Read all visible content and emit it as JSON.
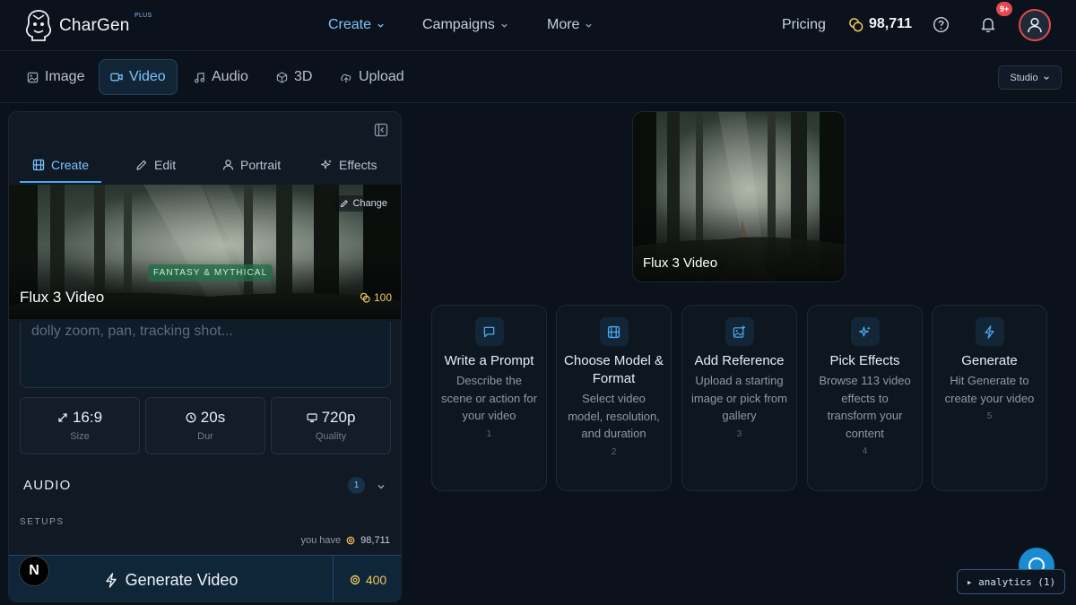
{
  "brand": {
    "name": "CharGen",
    "badge": "PLUS"
  },
  "nav": {
    "links": [
      {
        "label": "Create",
        "active": true
      },
      {
        "label": "Campaigns",
        "active": false
      },
      {
        "label": "More",
        "active": false
      }
    ],
    "pricing": "Pricing",
    "credits": "98,711",
    "notifications_badge": "9+"
  },
  "media_tabs": [
    {
      "label": "Image",
      "icon": "image-icon"
    },
    {
      "label": "Video",
      "icon": "video-icon",
      "active": true
    },
    {
      "label": "Audio",
      "icon": "music-icon"
    },
    {
      "label": "3D",
      "icon": "cube-icon"
    },
    {
      "label": "Upload",
      "icon": "upload-icon"
    }
  ],
  "studio_select": "Studio",
  "panel": {
    "tabs": [
      {
        "label": "Create",
        "icon": "film-icon",
        "active": true
      },
      {
        "label": "Edit",
        "icon": "pencil-icon"
      },
      {
        "label": "Portrait",
        "icon": "user-icon"
      },
      {
        "label": "Effects",
        "icon": "sparkles-icon"
      }
    ],
    "model": {
      "change_label": "Change",
      "genre": "FANTASY & MYTHICAL",
      "name": "Flux 3 Video",
      "cost": "100"
    },
    "prompt_placeholder": "dolly zoom, pan, tracking shot...",
    "options": [
      {
        "value": "16:9",
        "label": "Size",
        "icon": "resize-icon"
      },
      {
        "value": "20s",
        "label": "Dur",
        "icon": "clock-icon"
      },
      {
        "value": "720p",
        "label": "Quality",
        "icon": "monitor-icon"
      }
    ],
    "audio": {
      "title": "AUDIO",
      "count": "1"
    },
    "setups_label": "SETUPS",
    "you_have_label": "you have",
    "you_have_value": "98,711",
    "generate_label": "Generate Video",
    "generate_cost": "400"
  },
  "preview": {
    "title": "Flux 3 Video"
  },
  "steps": [
    {
      "title": "Write a Prompt",
      "desc": "Describe the scene or action for your video",
      "num": "1",
      "icon": "message-square-icon"
    },
    {
      "title": "Choose Model & Format",
      "desc": "Select video model, resolution, and duration",
      "num": "2",
      "icon": "film-icon"
    },
    {
      "title": "Add Reference",
      "desc": "Upload a starting image or pick from gallery",
      "num": "3",
      "icon": "image-plus-icon"
    },
    {
      "title": "Pick Effects",
      "desc": "Browse 113 video effects to transform your content",
      "num": "4",
      "icon": "sparkles-icon"
    },
    {
      "title": "Generate",
      "desc": "Hit Generate to create your video",
      "num": "5",
      "icon": "zap-icon"
    }
  ],
  "analytics_label": "▸ analytics (1)",
  "nextjs_badge": "N",
  "colors": {
    "accent": "#7cc5ff",
    "gold": "#f0c75e",
    "danger": "#e5484d",
    "background": "#0b121c"
  }
}
